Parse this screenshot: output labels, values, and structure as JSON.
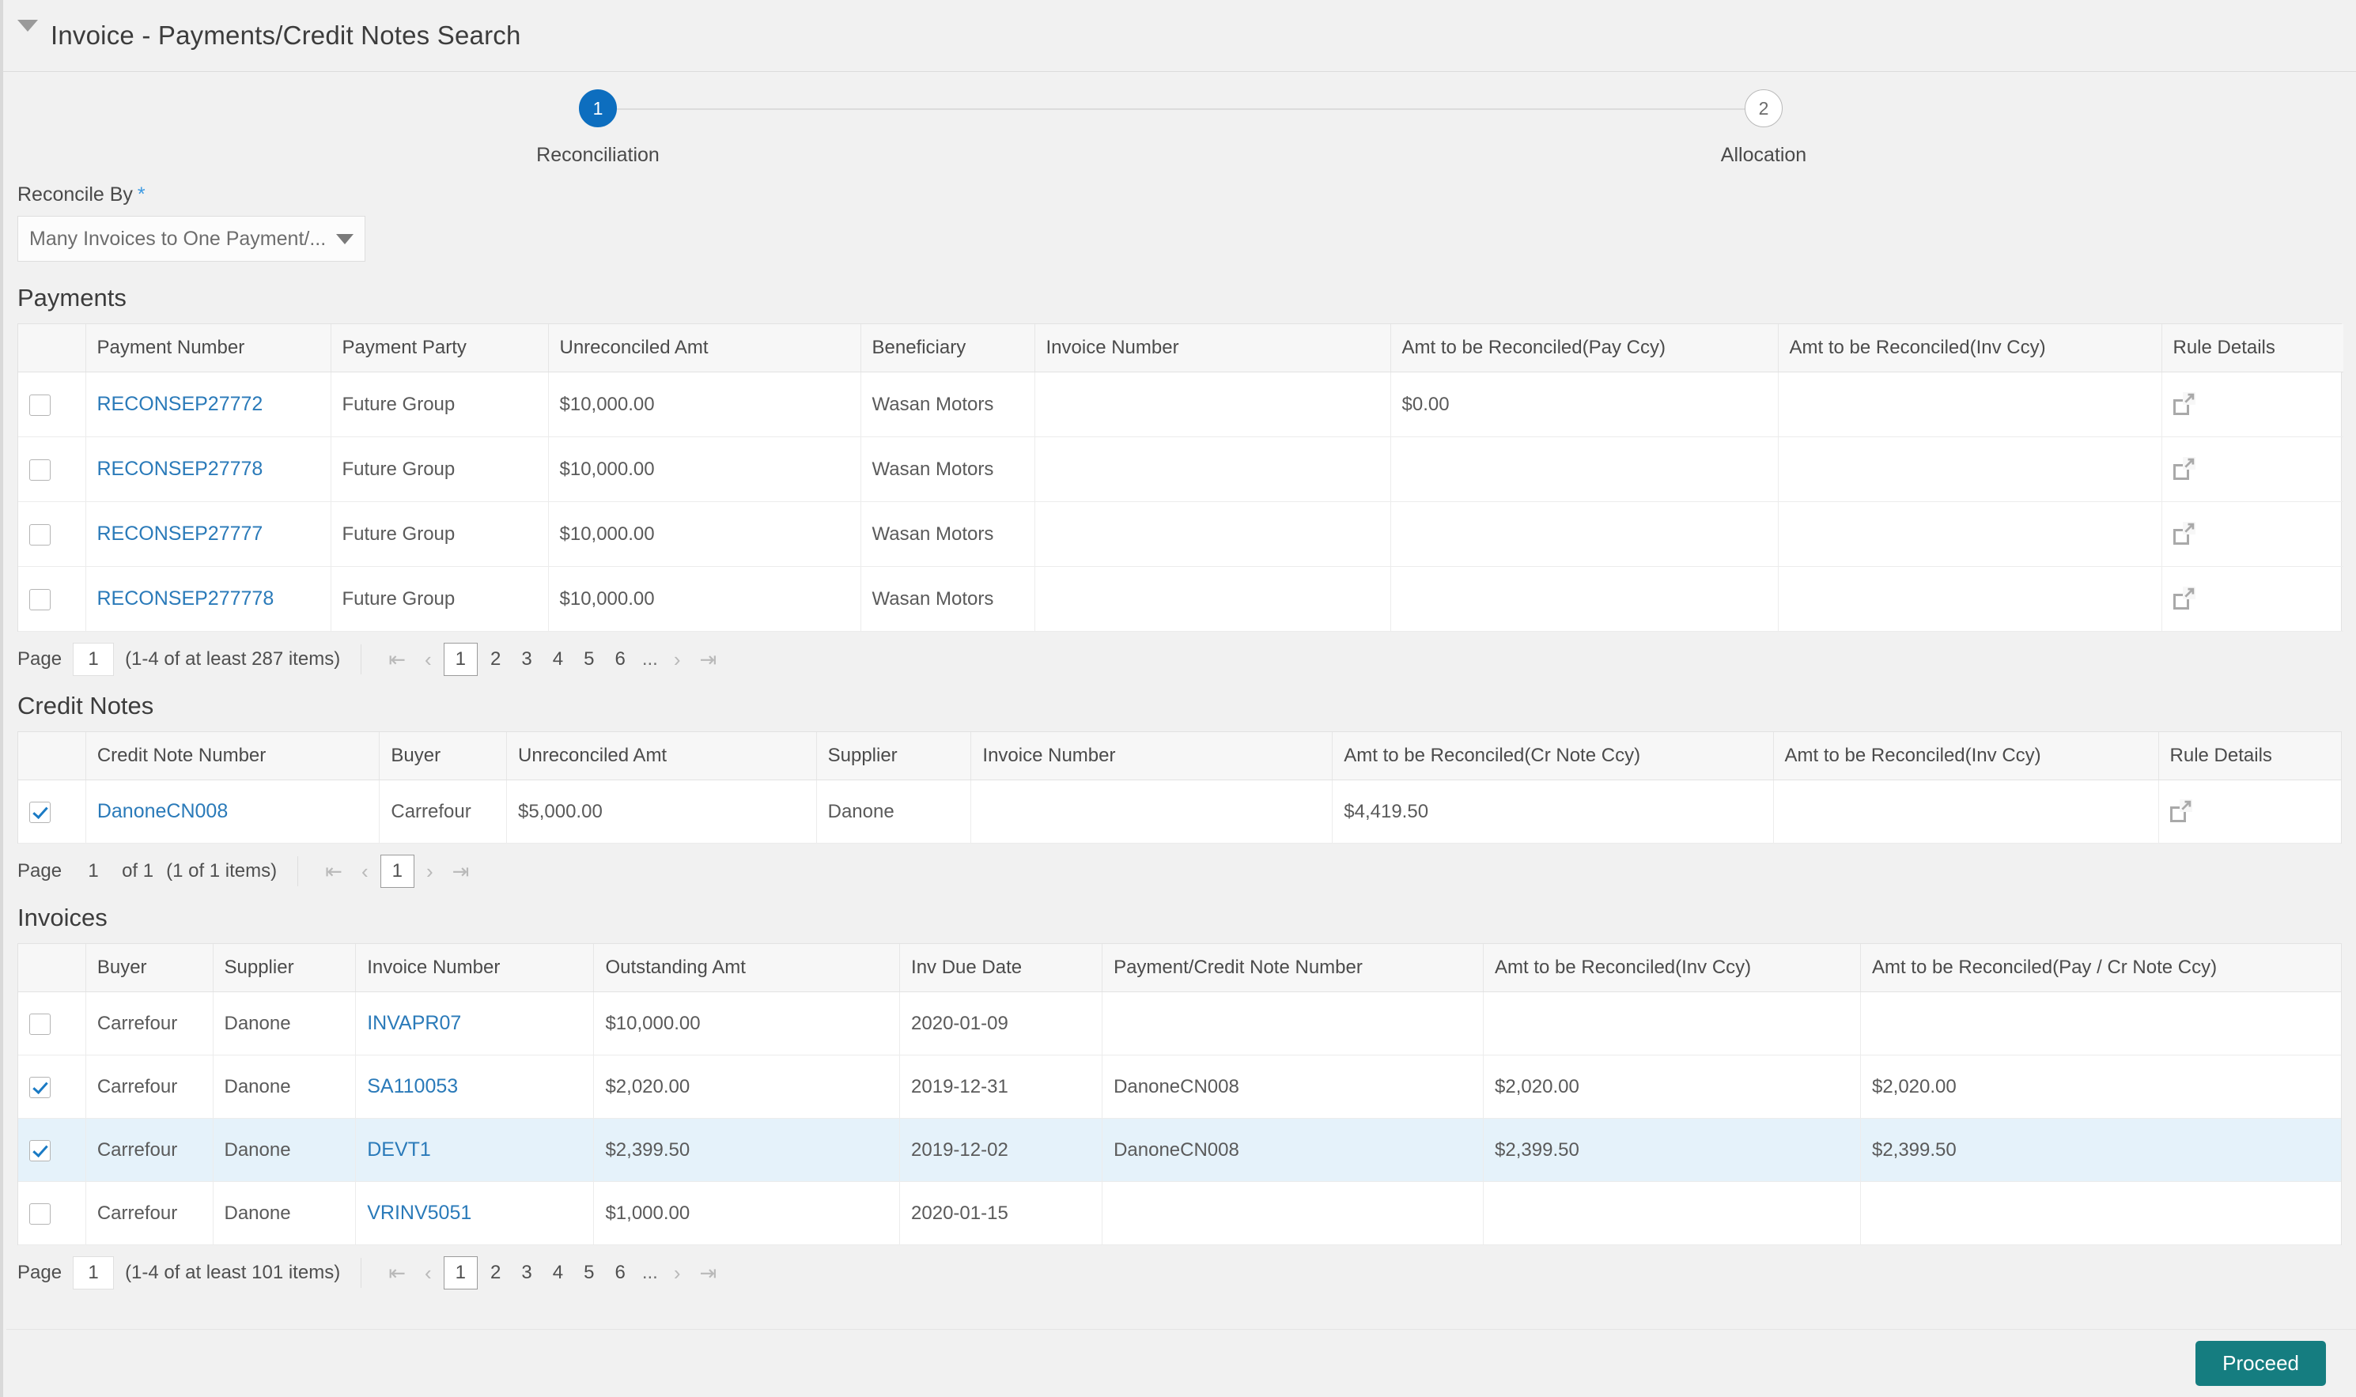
{
  "header": {
    "collapse_icon": "caret-down-icon",
    "title": "Invoice - Payments/Credit Notes Search"
  },
  "stepper": {
    "steps": [
      {
        "number": "1",
        "label": "Reconciliation",
        "state": "active"
      },
      {
        "number": "2",
        "label": "Allocation",
        "state": "inactive"
      }
    ],
    "active_color": "#0d6ebf"
  },
  "reconcile_by": {
    "label": "Reconcile By",
    "required_marker": "*",
    "value": "Many Invoices to One Payment/...",
    "caret_icon": "chevron-down-icon"
  },
  "payments": {
    "title": "Payments",
    "columns": [
      "",
      "Payment Number",
      "Payment Party",
      "Unreconciled Amt",
      "Beneficiary",
      "Invoice Number",
      "Amt to be Reconciled(Pay Ccy)",
      "Amt to be Reconciled(Inv Ccy)",
      "Rule Details"
    ],
    "rows": [
      {
        "selected": false,
        "payment_number": "RECONSEP27772",
        "payment_party": "Future Group",
        "unreconciled_amt": "$10,000.00",
        "beneficiary": "Wasan Motors",
        "invoice_number": "",
        "amt_pay_ccy": "$0.00",
        "amt_inv_ccy": "",
        "rule_details_icon": "external-link-icon"
      },
      {
        "selected": false,
        "payment_number": "RECONSEP27778",
        "payment_party": "Future Group",
        "unreconciled_amt": "$10,000.00",
        "beneficiary": "Wasan Motors",
        "invoice_number": "",
        "amt_pay_ccy": "",
        "amt_inv_ccy": "",
        "rule_details_icon": "external-link-icon"
      },
      {
        "selected": false,
        "payment_number": "RECONSEP27777",
        "payment_party": "Future Group",
        "unreconciled_amt": "$10,000.00",
        "beneficiary": "Wasan Motors",
        "invoice_number": "",
        "amt_pay_ccy": "",
        "amt_inv_ccy": "",
        "rule_details_icon": "external-link-icon"
      },
      {
        "selected": false,
        "payment_number": "RECONSEP277778",
        "payment_party": "Future Group",
        "unreconciled_amt": "$10,000.00",
        "beneficiary": "Wasan Motors",
        "invoice_number": "",
        "amt_pay_ccy": "",
        "amt_inv_ccy": "",
        "rule_details_icon": "external-link-icon"
      }
    ],
    "pager": {
      "page_label": "Page",
      "page_value": "1",
      "summary": "(1-4 of at least 287 items)",
      "first_icon": "first-page-icon",
      "prev_icon": "previous-page-icon",
      "next_icon": "next-page-icon",
      "last_icon": "last-page-icon",
      "numbers": [
        "1",
        "2",
        "3",
        "4",
        "5",
        "6"
      ],
      "ellipsis": "...",
      "current": "1"
    }
  },
  "credit_notes": {
    "title": "Credit Notes",
    "columns": [
      "",
      "Credit Note Number",
      "Buyer",
      "Unreconciled Amt",
      "Supplier",
      "Invoice Number",
      "Amt to be Reconciled(Cr Note Ccy)",
      "Amt to be Reconciled(Inv Ccy)",
      "Rule Details"
    ],
    "rows": [
      {
        "selected": true,
        "credit_note_number": "DanoneCN008",
        "buyer": "Carrefour",
        "unreconciled_amt": "$5,000.00",
        "supplier": "Danone",
        "invoice_number": "",
        "amt_cr_note_ccy": "$4,419.50",
        "amt_inv_ccy": "",
        "rule_details_icon": "external-link-icon"
      }
    ],
    "pager": {
      "page_label": "Page",
      "page_value": "1",
      "of_total": "of 1",
      "summary": "(1 of 1 items)",
      "first_icon": "first-page-icon",
      "prev_icon": "previous-page-icon",
      "next_icon": "next-page-icon",
      "last_icon": "last-page-icon",
      "numbers": [
        "1"
      ],
      "current": "1"
    }
  },
  "invoices": {
    "title": "Invoices",
    "columns": [
      "",
      "Buyer",
      "Supplier",
      "Invoice Number",
      "Outstanding Amt",
      "Inv Due Date",
      "Payment/Credit Note Number",
      "Amt to be Reconciled(Inv Ccy)",
      "Amt to be Reconciled(Pay / Cr Note Ccy)"
    ],
    "rows": [
      {
        "selected": false,
        "highlighted": false,
        "buyer": "Carrefour",
        "supplier": "Danone",
        "invoice_number": "INVAPR07",
        "outstanding_amt": "$10,000.00",
        "inv_due_date": "2020-01-09",
        "payment_cn_number": "",
        "amt_inv_ccy": "",
        "amt_pay_cr_ccy": ""
      },
      {
        "selected": true,
        "highlighted": false,
        "buyer": "Carrefour",
        "supplier": "Danone",
        "invoice_number": "SA110053",
        "outstanding_amt": "$2,020.00",
        "inv_due_date": "2019-12-31",
        "payment_cn_number": "DanoneCN008",
        "amt_inv_ccy": "$2,020.00",
        "amt_pay_cr_ccy": "$2,020.00"
      },
      {
        "selected": true,
        "highlighted": true,
        "buyer": "Carrefour",
        "supplier": "Danone",
        "invoice_number": "DEVT1",
        "outstanding_amt": "$2,399.50",
        "inv_due_date": "2019-12-02",
        "payment_cn_number": "DanoneCN008",
        "amt_inv_ccy": "$2,399.50",
        "amt_pay_cr_ccy": "$2,399.50"
      },
      {
        "selected": false,
        "highlighted": false,
        "buyer": "Carrefour",
        "supplier": "Danone",
        "invoice_number": "VRINV5051",
        "outstanding_amt": "$1,000.00",
        "inv_due_date": "2020-01-15",
        "payment_cn_number": "",
        "amt_inv_ccy": "",
        "amt_pay_cr_ccy": ""
      }
    ],
    "pager": {
      "page_label": "Page",
      "page_value": "1",
      "summary": "(1-4 of at least 101 items)",
      "first_icon": "first-page-icon",
      "prev_icon": "previous-page-icon",
      "next_icon": "next-page-icon",
      "last_icon": "last-page-icon",
      "numbers": [
        "1",
        "2",
        "3",
        "4",
        "5",
        "6"
      ],
      "ellipsis": "...",
      "current": "1"
    }
  },
  "footer": {
    "proceed_label": "Proceed",
    "proceed_color": "#157d80"
  }
}
